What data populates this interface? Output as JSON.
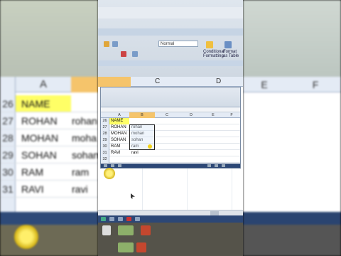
{
  "background": {
    "columns_left": [
      "A"
    ],
    "columns_right": [
      "E",
      "F"
    ],
    "rows": [
      {
        "num": "26",
        "a": "NAME",
        "b": ""
      },
      {
        "num": "27",
        "a": "ROHAN",
        "b": "rohan"
      },
      {
        "num": "28",
        "a": "MOHAN",
        "b": "moha"
      },
      {
        "num": "29",
        "a": "SOHAN",
        "b": "sohan"
      },
      {
        "num": "30",
        "a": "RAM",
        "b": "ram"
      },
      {
        "num": "31",
        "a": "RAVI",
        "b": "ravi"
      }
    ]
  },
  "center": {
    "ribbon_input": "Normal",
    "ribbon_group_texts": [
      "Conditional Formatting",
      "Format as Table"
    ],
    "big_columns": [
      "C",
      "D"
    ],
    "sheet": {
      "columns": [
        "A",
        "B",
        "C",
        "D",
        "E",
        "F"
      ],
      "rows": [
        {
          "num": "26",
          "a": "NAME",
          "b": ""
        },
        {
          "num": "27",
          "a": "ROHAN",
          "b": "rohan"
        },
        {
          "num": "28",
          "a": "MOHAN",
          "b": "mohan"
        },
        {
          "num": "29",
          "a": "SOHAN",
          "b": "sohan"
        },
        {
          "num": "30",
          "a": "RAM",
          "b": "ram"
        },
        {
          "num": "31",
          "a": "RAVI",
          "b": "ravi"
        },
        {
          "num": "32",
          "a": "",
          "b": ""
        }
      ]
    },
    "colors": {
      "name_highlight": "#ffff66",
      "column_highlight": "#f5c46b",
      "taskbar": "#2c4776"
    }
  }
}
